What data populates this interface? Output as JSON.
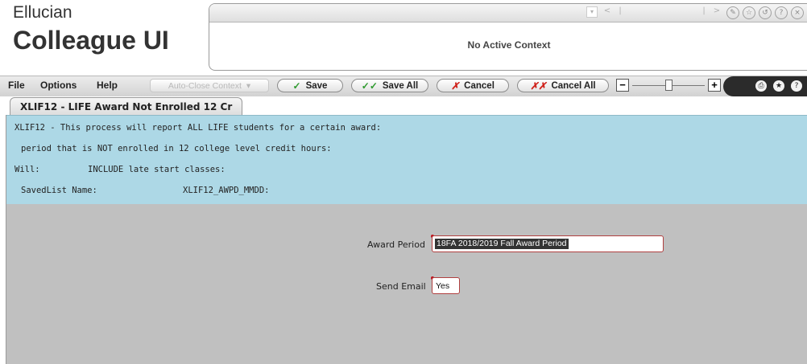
{
  "brand": {
    "line1": "Ellucian",
    "line2": "Colleague UI"
  },
  "context": {
    "text": "No Active Context",
    "nav_icons": [
      "dropdown-icon",
      "prev-icon",
      "next-icon"
    ],
    "icons": [
      "edit-icon",
      "favorite-icon",
      "history-icon",
      "help-icon",
      "close-icon"
    ]
  },
  "toolbar": {
    "menus": [
      "File",
      "Options",
      "Help"
    ],
    "auto_close": "Auto-Close Context",
    "save": "Save",
    "save_all": "Save All",
    "cancel": "Cancel",
    "cancel_all": "Cancel All",
    "zoom_minus": "−",
    "zoom_plus": "+",
    "zoom_level": 0.5,
    "right_icons": [
      "print-icon",
      "favorite-icon",
      "help-icon"
    ]
  },
  "tab": {
    "label": "XLIF12 - LIFE Award Not Enrolled 12 Cr"
  },
  "info": {
    "line1": "XLIF12 - This process will report ALL LIFE students for a certain award:",
    "line2": "period that is NOT enrolled in 12 college level credit hours:",
    "line3_label": "Will:",
    "line3_value": "INCLUDE late start classes:",
    "line4_label": "SavedList Name:",
    "line4_value": "XLIF12_AWPD_MMDD:"
  },
  "form": {
    "award_period_label": "Award Period",
    "award_period_value": "18FA 2018/2019 Fall Award Period",
    "send_email_label": "Send Email",
    "send_email_value": "Yes"
  },
  "colors": {
    "info_bg": "#add8e6",
    "main_bg": "#c0c0c0",
    "required": "#c0101a"
  }
}
